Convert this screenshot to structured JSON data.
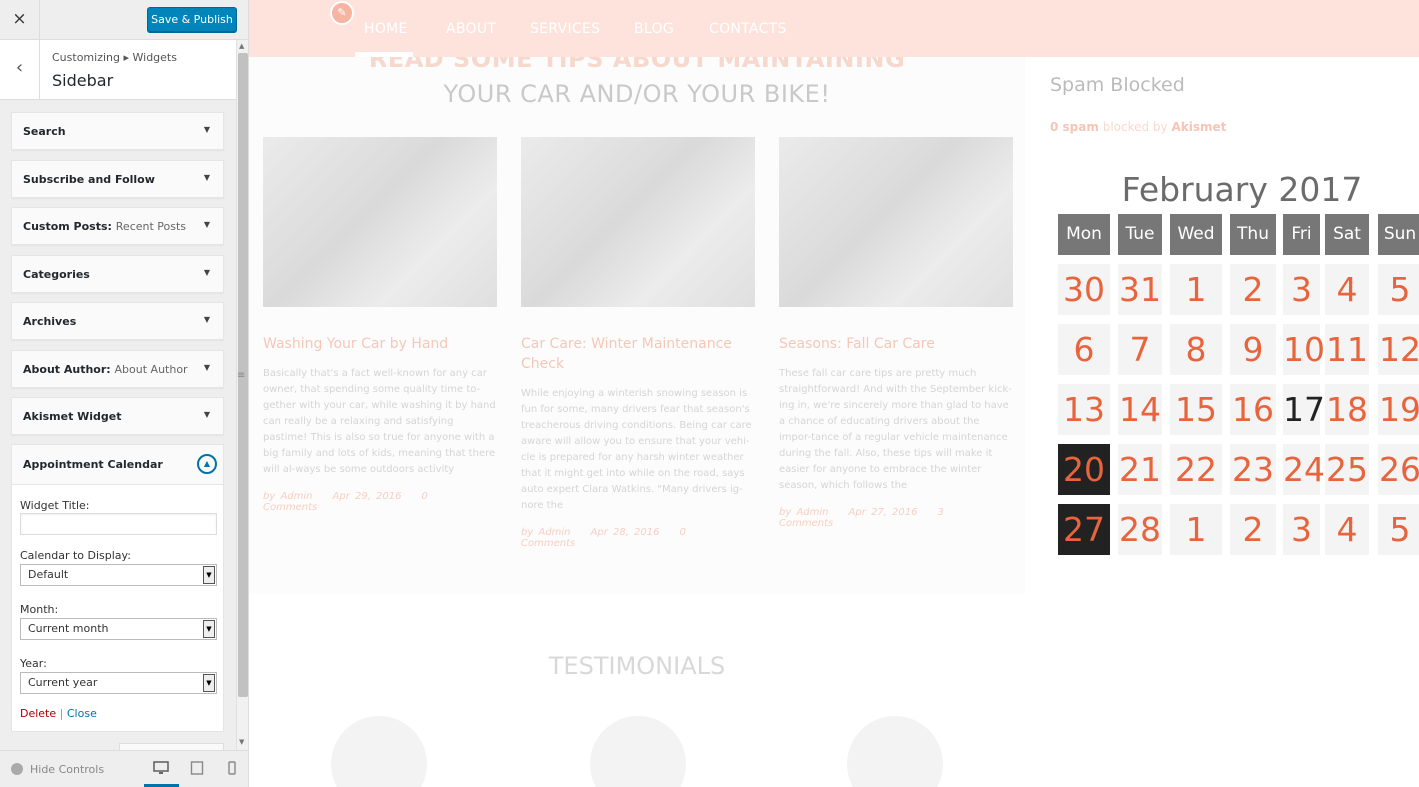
{
  "customizer": {
    "close_icon": "×",
    "save_label": "Save & Publish",
    "back_icon": "‹",
    "breadcrumb": "Customizing ▸ Widgets",
    "panel_title": "Sidebar",
    "widgets": [
      {
        "title": "Search",
        "subtitle": ""
      },
      {
        "title": "Subscribe and Follow",
        "subtitle": ""
      },
      {
        "title": "Custom Posts:",
        "subtitle": "Recent Posts"
      },
      {
        "title": "Categories",
        "subtitle": ""
      },
      {
        "title": "Archives",
        "subtitle": ""
      },
      {
        "title": "About Author:",
        "subtitle": "About Author"
      },
      {
        "title": "Akismet Widget",
        "subtitle": ""
      }
    ],
    "open_widget": {
      "title": "Appointment Calendar",
      "widget_title_label": "Widget Title:",
      "widget_title_value": "",
      "calendar_label": "Calendar to Display:",
      "calendar_value": "Default",
      "month_label": "Month:",
      "month_value": "Current month",
      "year_label": "Year:",
      "year_value": "Current year",
      "delete_label": "Delete",
      "separator": "|",
      "close_label": "Close"
    },
    "hide_controls": "Hide Controls",
    "accent_color": "#0085ba"
  },
  "preview": {
    "nav": [
      "HOME",
      "ABOUT",
      "SERVICES",
      "BLOG",
      "CONTACTS"
    ],
    "heading_line1": "READ SOME TIPS ABOUT MAINTAINING",
    "heading_line2": "YOUR CAR AND/OR YOUR BIKE!",
    "posts": [
      {
        "title": "Washing Your Car by Hand",
        "body": "Basically that's a fact well-known for any car owner, that spending some quality time to-gether with your car, while washing it by hand can really be a relaxing and satisfying pastime! This is also so true for anyone with a big family and lots of kids, meaning that there will al-ways be some outdoors activity",
        "author": "by Admin",
        "date": "Apr 29, 2016",
        "comments": "0 Comments"
      },
      {
        "title": "Car Care: Winter Maintenance Check",
        "body": "While enjoying a winterish snowing season is fun for some, many drivers fear that season's treacherous driving conditions. Being car care aware will allow you to ensure that your vehi-cle is prepared for any harsh winter weather that it might get into while on the road, says auto expert Clara Watkins. \"Many drivers ig-nore the",
        "author": "by Admin",
        "date": "Apr 28, 2016",
        "comments": "0 Comments"
      },
      {
        "title": "Seasons: Fall Car Care",
        "body": "These fall car care tips are pretty much straightforward! And with the September kick-ing in, we're sincerely more than glad to have a chance of educating drivers about the impor-tance of a regular vehicle maintenance during the fall. Also, these tips will make it easier for anyone to embrace the winter season, which follows the",
        "author": "by Admin",
        "date": "Apr 27, 2016",
        "comments": "3 Comments"
      }
    ],
    "testimonials": "TESTIMONIALS",
    "spam_title": "Spam Blocked",
    "spam_count": "0 spam",
    "spam_mid": "blocked by",
    "spam_by": "Akismet",
    "calendar": {
      "title": "February 2017",
      "days": [
        "Mon",
        "Tue",
        "Wed",
        "Thu",
        "Fri",
        "Sat",
        "Sun"
      ],
      "weeks": [
        [
          "30",
          "31",
          "1",
          "2",
          "3",
          "4",
          "5"
        ],
        [
          "6",
          "7",
          "8",
          "9",
          "10",
          "11",
          "12"
        ],
        [
          "13",
          "14",
          "15",
          "16",
          "17",
          "18",
          "19"
        ],
        [
          "20",
          "21",
          "22",
          "23",
          "24",
          "25",
          "26"
        ],
        [
          "27",
          "28",
          "1",
          "2",
          "3",
          "4",
          "5"
        ]
      ],
      "today": "17",
      "selected": [
        "20",
        "27"
      ],
      "number_color": "#e8643d"
    }
  }
}
